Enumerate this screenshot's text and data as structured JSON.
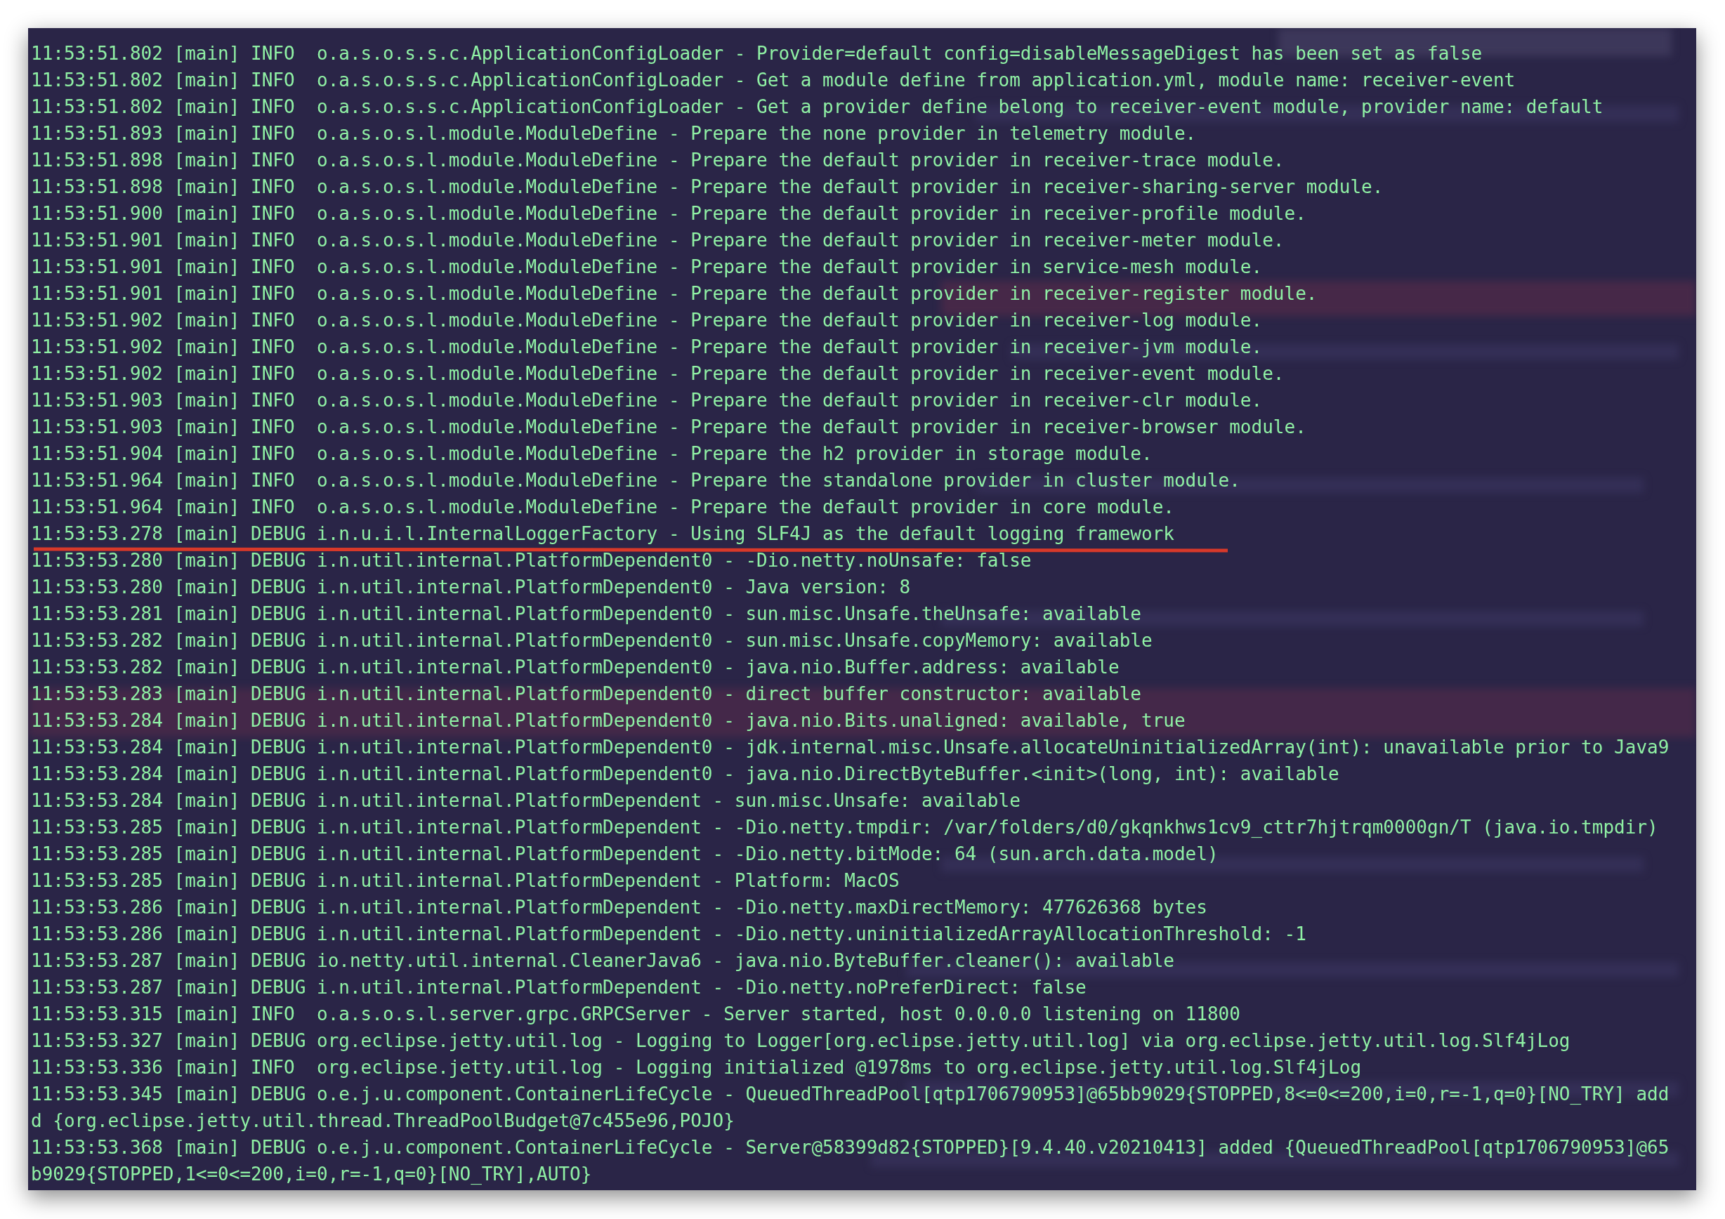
{
  "terminal": {
    "lines": [
      {
        "text": "11:53:51.802 [main] INFO  o.a.s.o.s.s.c.ApplicationConfigLoader - Provider=default config=disableMessageDigest has been set as false",
        "underlined": false
      },
      {
        "text": "11:53:51.802 [main] INFO  o.a.s.o.s.s.c.ApplicationConfigLoader - Get a module define from application.yml, module name: receiver-event",
        "underlined": false
      },
      {
        "text": "11:53:51.802 [main] INFO  o.a.s.o.s.s.c.ApplicationConfigLoader - Get a provider define belong to receiver-event module, provider name: default",
        "underlined": false
      },
      {
        "text": "11:53:51.893 [main] INFO  o.a.s.o.s.l.module.ModuleDefine - Prepare the none provider in telemetry module.",
        "underlined": false
      },
      {
        "text": "11:53:51.898 [main] INFO  o.a.s.o.s.l.module.ModuleDefine - Prepare the default provider in receiver-trace module.",
        "underlined": false
      },
      {
        "text": "11:53:51.898 [main] INFO  o.a.s.o.s.l.module.ModuleDefine - Prepare the default provider in receiver-sharing-server module.",
        "underlined": false
      },
      {
        "text": "11:53:51.900 [main] INFO  o.a.s.o.s.l.module.ModuleDefine - Prepare the default provider in receiver-profile module.",
        "underlined": false
      },
      {
        "text": "11:53:51.901 [main] INFO  o.a.s.o.s.l.module.ModuleDefine - Prepare the default provider in receiver-meter module.",
        "underlined": false
      },
      {
        "text": "11:53:51.901 [main] INFO  o.a.s.o.s.l.module.ModuleDefine - Prepare the default provider in service-mesh module.",
        "underlined": false
      },
      {
        "text": "11:53:51.901 [main] INFO  o.a.s.o.s.l.module.ModuleDefine - Prepare the default provider in receiver-register module.",
        "underlined": false
      },
      {
        "text": "11:53:51.902 [main] INFO  o.a.s.o.s.l.module.ModuleDefine - Prepare the default provider in receiver-log module.",
        "underlined": false
      },
      {
        "text": "11:53:51.902 [main] INFO  o.a.s.o.s.l.module.ModuleDefine - Prepare the default provider in receiver-jvm module.",
        "underlined": false
      },
      {
        "text": "11:53:51.902 [main] INFO  o.a.s.o.s.l.module.ModuleDefine - Prepare the default provider in receiver-event module.",
        "underlined": false
      },
      {
        "text": "11:53:51.903 [main] INFO  o.a.s.o.s.l.module.ModuleDefine - Prepare the default provider in receiver-clr module.",
        "underlined": false
      },
      {
        "text": "11:53:51.903 [main] INFO  o.a.s.o.s.l.module.ModuleDefine - Prepare the default provider in receiver-browser module.",
        "underlined": false
      },
      {
        "text": "11:53:51.904 [main] INFO  o.a.s.o.s.l.module.ModuleDefine - Prepare the h2 provider in storage module.",
        "underlined": false
      },
      {
        "text": "11:53:51.964 [main] INFO  o.a.s.o.s.l.module.ModuleDefine - Prepare the standalone provider in cluster module.",
        "underlined": false
      },
      {
        "text": "11:53:51.964 [main] INFO  o.a.s.o.s.l.module.ModuleDefine - Prepare the default provider in core module.",
        "underlined": false
      },
      {
        "text": "11:53:53.278 [main] DEBUG i.n.u.i.l.InternalLoggerFactory - Using SLF4J as the default logging framework",
        "underlined": true
      },
      {
        "text": "11:53:53.280 [main] DEBUG i.n.util.internal.PlatformDependent0 - -Dio.netty.noUnsafe: false",
        "underlined": false
      },
      {
        "text": "11:53:53.280 [main] DEBUG i.n.util.internal.PlatformDependent0 - Java version: 8",
        "underlined": false
      },
      {
        "text": "11:53:53.281 [main] DEBUG i.n.util.internal.PlatformDependent0 - sun.misc.Unsafe.theUnsafe: available",
        "underlined": false
      },
      {
        "text": "11:53:53.282 [main] DEBUG i.n.util.internal.PlatformDependent0 - sun.misc.Unsafe.copyMemory: available",
        "underlined": false
      },
      {
        "text": "11:53:53.282 [main] DEBUG i.n.util.internal.PlatformDependent0 - java.nio.Buffer.address: available",
        "underlined": false
      },
      {
        "text": "11:53:53.283 [main] DEBUG i.n.util.internal.PlatformDependent0 - direct buffer constructor: available",
        "underlined": false
      },
      {
        "text": "11:53:53.284 [main] DEBUG i.n.util.internal.PlatformDependent0 - java.nio.Bits.unaligned: available, true",
        "underlined": false
      },
      {
        "text": "11:53:53.284 [main] DEBUG i.n.util.internal.PlatformDependent0 - jdk.internal.misc.Unsafe.allocateUninitializedArray(int): unavailable prior to Java9",
        "underlined": false
      },
      {
        "text": "11:53:53.284 [main] DEBUG i.n.util.internal.PlatformDependent0 - java.nio.DirectByteBuffer.<init>(long, int): available",
        "underlined": false
      },
      {
        "text": "11:53:53.284 [main] DEBUG i.n.util.internal.PlatformDependent - sun.misc.Unsafe: available",
        "underlined": false
      },
      {
        "text": "11:53:53.285 [main] DEBUG i.n.util.internal.PlatformDependent - -Dio.netty.tmpdir: /var/folders/d0/gkqnkhws1cv9_cttr7hjtrqm0000gn/T (java.io.tmpdir)",
        "underlined": false
      },
      {
        "text": "11:53:53.285 [main] DEBUG i.n.util.internal.PlatformDependent - -Dio.netty.bitMode: 64 (sun.arch.data.model)",
        "underlined": false
      },
      {
        "text": "11:53:53.285 [main] DEBUG i.n.util.internal.PlatformDependent - Platform: MacOS",
        "underlined": false
      },
      {
        "text": "11:53:53.286 [main] DEBUG i.n.util.internal.PlatformDependent - -Dio.netty.maxDirectMemory: 477626368 bytes",
        "underlined": false
      },
      {
        "text": "11:53:53.286 [main] DEBUG i.n.util.internal.PlatformDependent - -Dio.netty.uninitializedArrayAllocationThreshold: -1",
        "underlined": false
      },
      {
        "text": "11:53:53.287 [main] DEBUG io.netty.util.internal.CleanerJava6 - java.nio.ByteBuffer.cleaner(): available",
        "underlined": false
      },
      {
        "text": "11:53:53.287 [main] DEBUG i.n.util.internal.PlatformDependent - -Dio.netty.noPreferDirect: false",
        "underlined": false
      },
      {
        "text": "11:53:53.315 [main] INFO  o.a.s.o.s.l.server.grpc.GRPCServer - Server started, host 0.0.0.0 listening on 11800",
        "underlined": false
      },
      {
        "text": "11:53:53.327 [main] DEBUG org.eclipse.jetty.util.log - Logging to Logger[org.eclipse.jetty.util.log] via org.eclipse.jetty.util.log.Slf4jLog",
        "underlined": false
      },
      {
        "text": "11:53:53.336 [main] INFO  org.eclipse.jetty.util.log - Logging initialized @1978ms to org.eclipse.jetty.util.log.Slf4jLog",
        "underlined": false
      },
      {
        "text": "11:53:53.345 [main] DEBUG o.e.j.u.component.ContainerLifeCycle - QueuedThreadPool[qtp1706790953]@65bb9029{STOPPED,8<=0<=200,i=0,r=-1,q=0}[NO_TRY] add",
        "underlined": false
      },
      {
        "text": "d {org.eclipse.jetty.util.thread.ThreadPoolBudget@7c455e96,POJO}",
        "underlined": false
      },
      {
        "text": "11:53:53.368 [main] DEBUG o.e.j.u.component.ContainerLifeCycle - Server@58399d82{STOPPED}[9.4.40.v20210413] added {QueuedThreadPool[qtp1706790953]@65",
        "underlined": false
      },
      {
        "text": "b9029{STOPPED,1<=0<=200,i=0,r=-1,q=0}[NO_TRY],AUTO}",
        "underlined": false
      }
    ]
  }
}
